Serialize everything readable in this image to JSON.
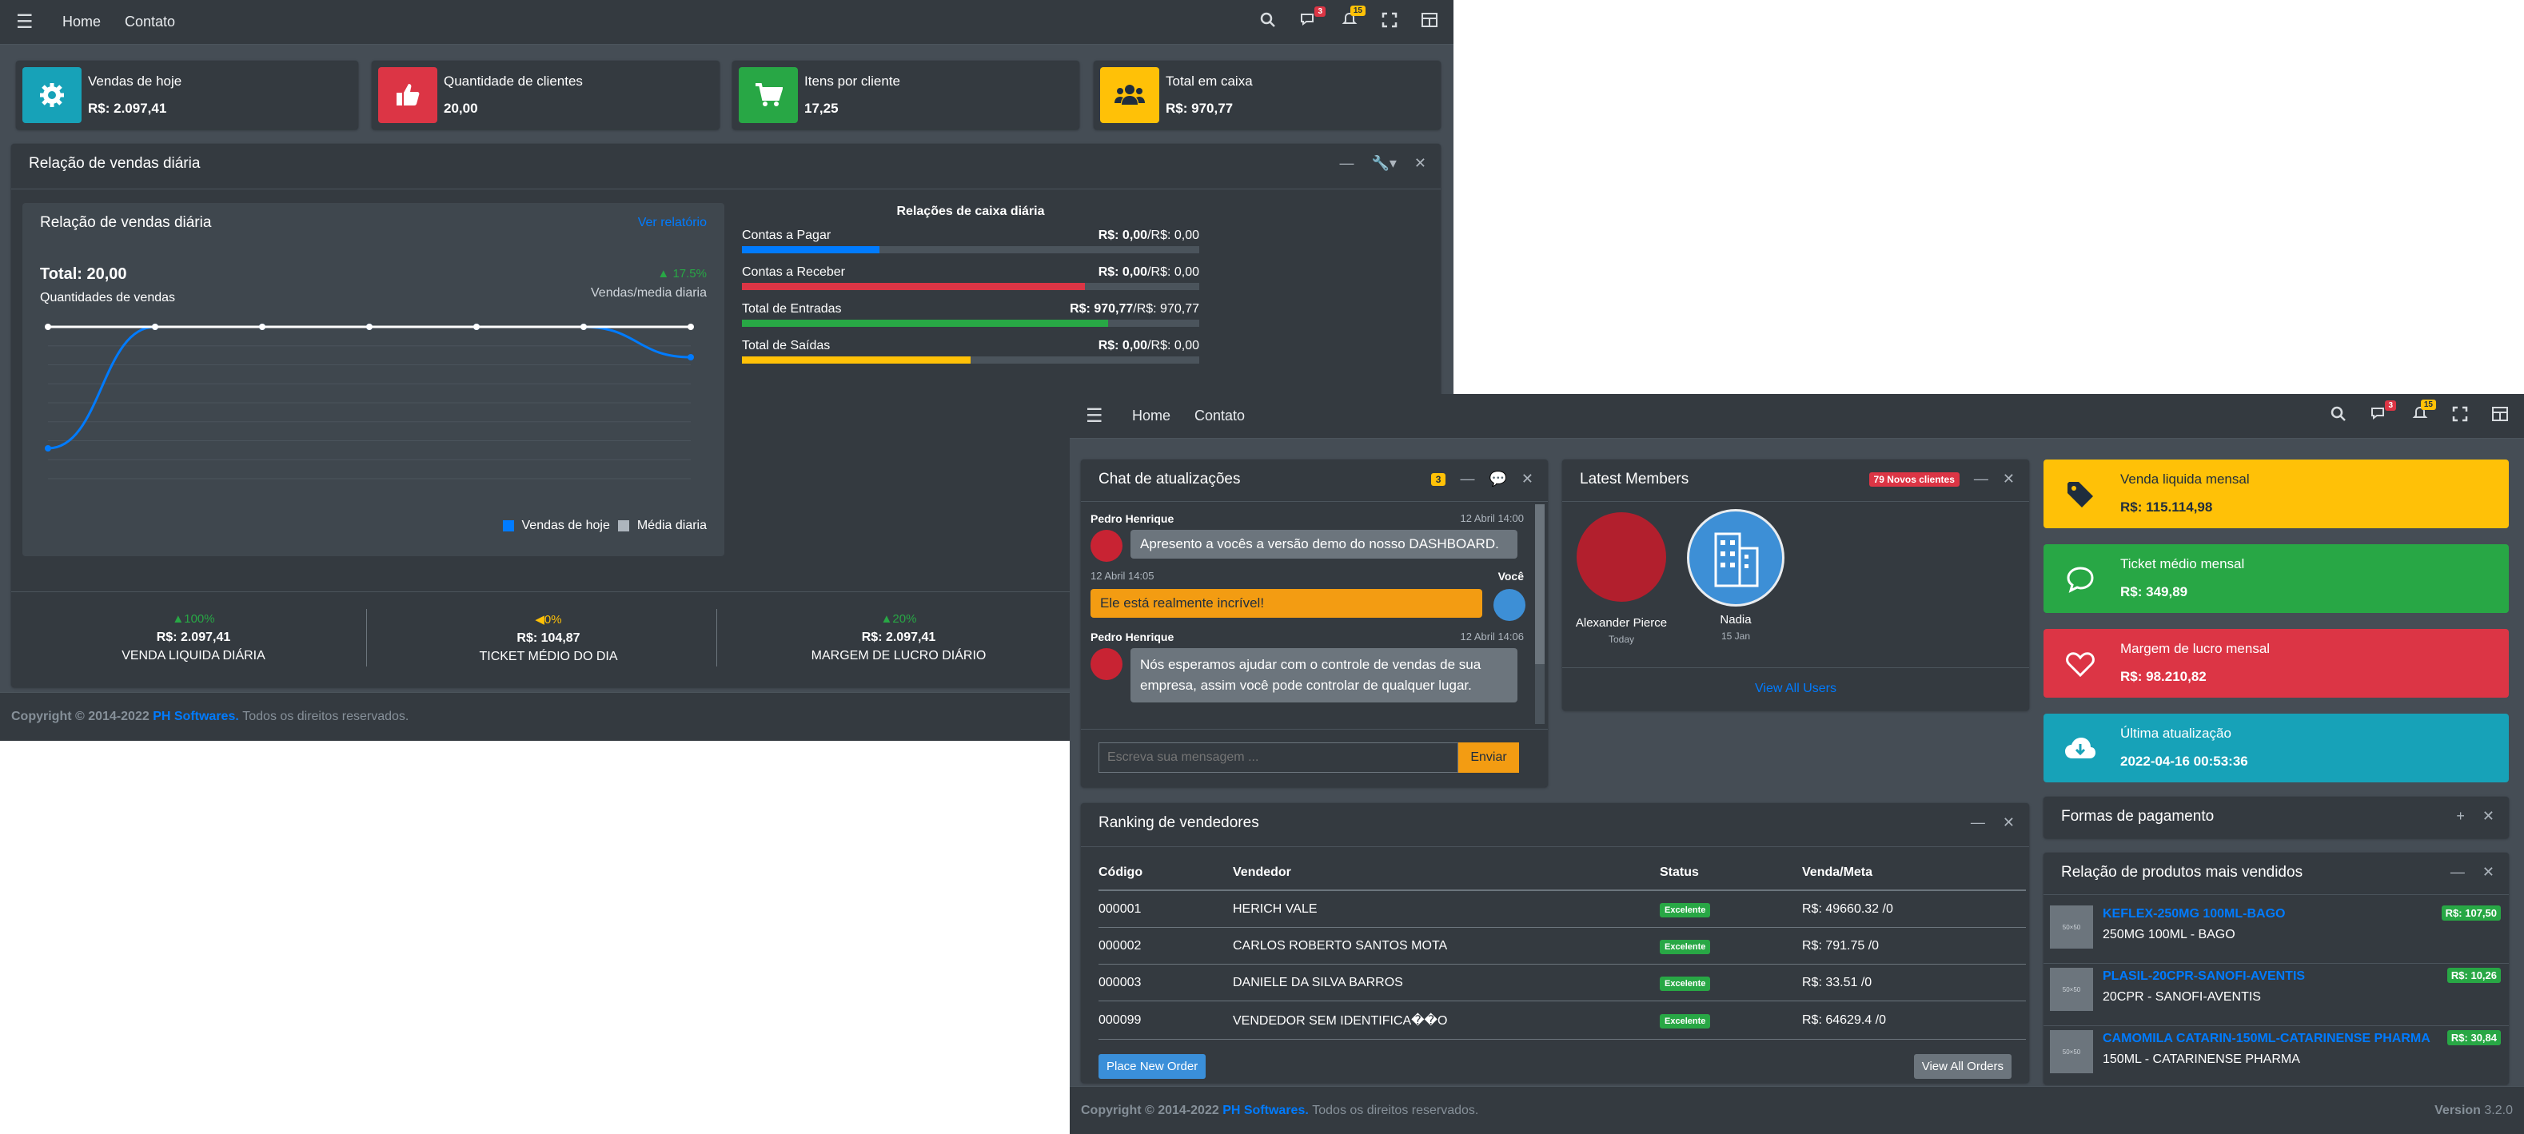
{
  "win_a": {
    "nav": {
      "home": "Home",
      "contato": "Contato",
      "notif_chat": "3",
      "notif_bell": "15"
    },
    "infoboxes": [
      {
        "label": "Vendas de hoje",
        "value": "R$: 2.097,41",
        "color": "#17a2b8",
        "icon": "gear-icon"
      },
      {
        "label": "Quantidade de clientes",
        "value": "20,00",
        "color": "#dc3545",
        "icon": "thumbs-up-icon"
      },
      {
        "label": "Itens por cliente",
        "value": "17,25",
        "color": "#28a745",
        "icon": "cart-icon"
      },
      {
        "label": "Total em caixa",
        "value": "R$: 970,77",
        "color": "#ffc107",
        "icon": "users-icon"
      }
    ],
    "card_title": "Relação de vendas diária",
    "chart": {
      "title": "Relação de vendas diária",
      "link": "Ver relatório",
      "total": "Total: 20,00",
      "subtitle": "Quantidades de vendas",
      "pct": "17.5%",
      "pct_label": "Vendas/media diaria",
      "legend": [
        "Vendas de hoje",
        "Média diaria"
      ]
    },
    "chart_data": {
      "type": "line",
      "x": [
        1,
        2,
        3,
        4,
        5,
        6,
        7
      ],
      "series": [
        {
          "name": "Vendas de hoje",
          "values": [
            4,
            20,
            20,
            20,
            20,
            20,
            16
          ]
        },
        {
          "name": "Média diaria",
          "values": [
            20,
            20,
            20,
            20,
            20,
            20,
            20
          ]
        }
      ],
      "ylim": [
        0,
        20
      ],
      "colors": [
        "#007bff",
        "#ffffff"
      ],
      "grid": true
    },
    "cash": {
      "title": "Relações de caixa diária",
      "rows": [
        {
          "label": "Contas a Pagar",
          "bold": "R$: 0,00",
          "rest": "/R$: 0,00",
          "color": "#007bff",
          "fill": 0.3
        },
        {
          "label": "Contas a Receber",
          "bold": "R$: 0,00",
          "rest": "/R$: 0,00",
          "color": "#dc3545",
          "fill": 0.75
        },
        {
          "label": "Total de Entradas",
          "bold": "R$: 970,77",
          "rest": "/R$: 970,77",
          "color": "#28a745",
          "fill": 0.8
        },
        {
          "label": "Total de Saídas",
          "bold": "R$: 0,00",
          "rest": "/R$: 0,00",
          "color": "#ffc107",
          "fill": 0.5
        }
      ]
    },
    "stats": [
      {
        "pct": "100%",
        "value": "R$: 2.097,41",
        "label": "VENDA LIQUIDA DIÁRIA",
        "color": "#28a745",
        "arrow": "▲"
      },
      {
        "pct": "0%",
        "value": "R$: 104,87",
        "label": "TICKET MÉDIO DO DIA",
        "color": "#ffc107",
        "arrow": "◀"
      },
      {
        "pct": "20%",
        "value": "R$: 2.097,41",
        "label": "MARGEM DE LUCRO DIÁRIO",
        "color": "#28a745",
        "arrow": "▲"
      }
    ],
    "footer": {
      "copy": "Copyright © 2014-2022",
      "brand": "PH Softwares.",
      "rest": "Todos os direitos reservados."
    }
  },
  "win_b": {
    "nav": {
      "home": "Home",
      "contato": "Contato",
      "notif_chat": "3",
      "notif_bell": "15"
    },
    "chat": {
      "title": "Chat de atualizações",
      "badge": "3",
      "messages": [
        {
          "name": "Pedro Henrique",
          "time": "12 Abril 14:00",
          "text": "Apresento a vocês a versão demo do nosso DASHBOARD."
        },
        {
          "name": "Você",
          "time": "12 Abril 14:05",
          "text": "Ele está realmente incrível!"
        },
        {
          "name": "Pedro Henrique",
          "time": "12 Abril 14:06",
          "text1": "Nós esperamos ajudar com o controle de vendas de sua",
          "text2": "empresa, assim você pode controlar de qualquer lugar."
        }
      ],
      "placeholder": "Escreva sua mensagem ...",
      "send": "Enviar"
    },
    "members": {
      "title": "Latest Members",
      "badge": "79 Novos clientes",
      "list": [
        {
          "name": "Alexander Pierce",
          "date": "Today"
        },
        {
          "name": "Nadia",
          "date": "15 Jan"
        }
      ],
      "view_all": "View All Users"
    },
    "boxes": [
      {
        "label": "Venda liquida mensal",
        "value": "R$: 115.114,98",
        "bg": "#ffc107",
        "fg": "#1f2d3d",
        "icon": "tag-icon"
      },
      {
        "label": "Ticket médio mensal",
        "value": "R$: 349,89",
        "bg": "#28a745",
        "fg": "#ffffff",
        "icon": "comment-icon"
      },
      {
        "label": "Margem de lucro mensal",
        "value": "R$: 98.210,82",
        "bg": "#dc3545",
        "fg": "#ffffff",
        "icon": "heart-icon"
      },
      {
        "label": "Última atualização",
        "value": "2022-04-16 00:53:36",
        "bg": "#17a2b8",
        "fg": "#ffffff",
        "icon": "cloud-download-icon"
      }
    ],
    "ranking": {
      "title": "Ranking de vendedores",
      "headers": [
        "Código",
        "Vendedor",
        "Status",
        "Venda/Meta"
      ],
      "rows": [
        {
          "code": "000001",
          "name": "HERICH VALE",
          "status": "Excelente",
          "sale": "R$: 49660.32 /0"
        },
        {
          "code": "000002",
          "name": "CARLOS ROBERTO SANTOS MOTA",
          "status": "Excelente",
          "sale": "R$: 791.75 /0"
        },
        {
          "code": "000003",
          "name": "DANIELE DA SILVA BARROS",
          "status": "Excelente",
          "sale": "R$: 33.51 /0"
        },
        {
          "code": "000099",
          "name": "VENDEDOR SEM IDENTIFICA��O",
          "status": "Excelente",
          "sale": "R$: 64629.4 /0"
        }
      ],
      "place_order": "Place New Order",
      "view_orders": "View All Orders"
    },
    "payments": {
      "title": "Formas de pagamento"
    },
    "products": {
      "title": "Relação de produtos mais vendidos",
      "list": [
        {
          "name": "KEFLEX-250MG 100ML-BAGO",
          "desc": "250MG 100ML - BAGO",
          "price": "R$: 107,50"
        },
        {
          "name": "PLASIL-20CPR-SANOFI-AVENTIS",
          "desc": "20CPR - SANOFI-AVENTIS",
          "price": "R$: 10,26"
        },
        {
          "name": "CAMOMILA CATARIN-150ML-CATARINENSE PHARMA",
          "desc": "150ML - CATARINENSE PHARMA",
          "price": "R$: 30,84"
        }
      ]
    },
    "footer": {
      "copy": "Copyright © 2014-2022",
      "brand": "PH Softwares.",
      "rest": "Todos os direitos reservados.",
      "version_label": "Version",
      "version": "3.2.0"
    }
  }
}
